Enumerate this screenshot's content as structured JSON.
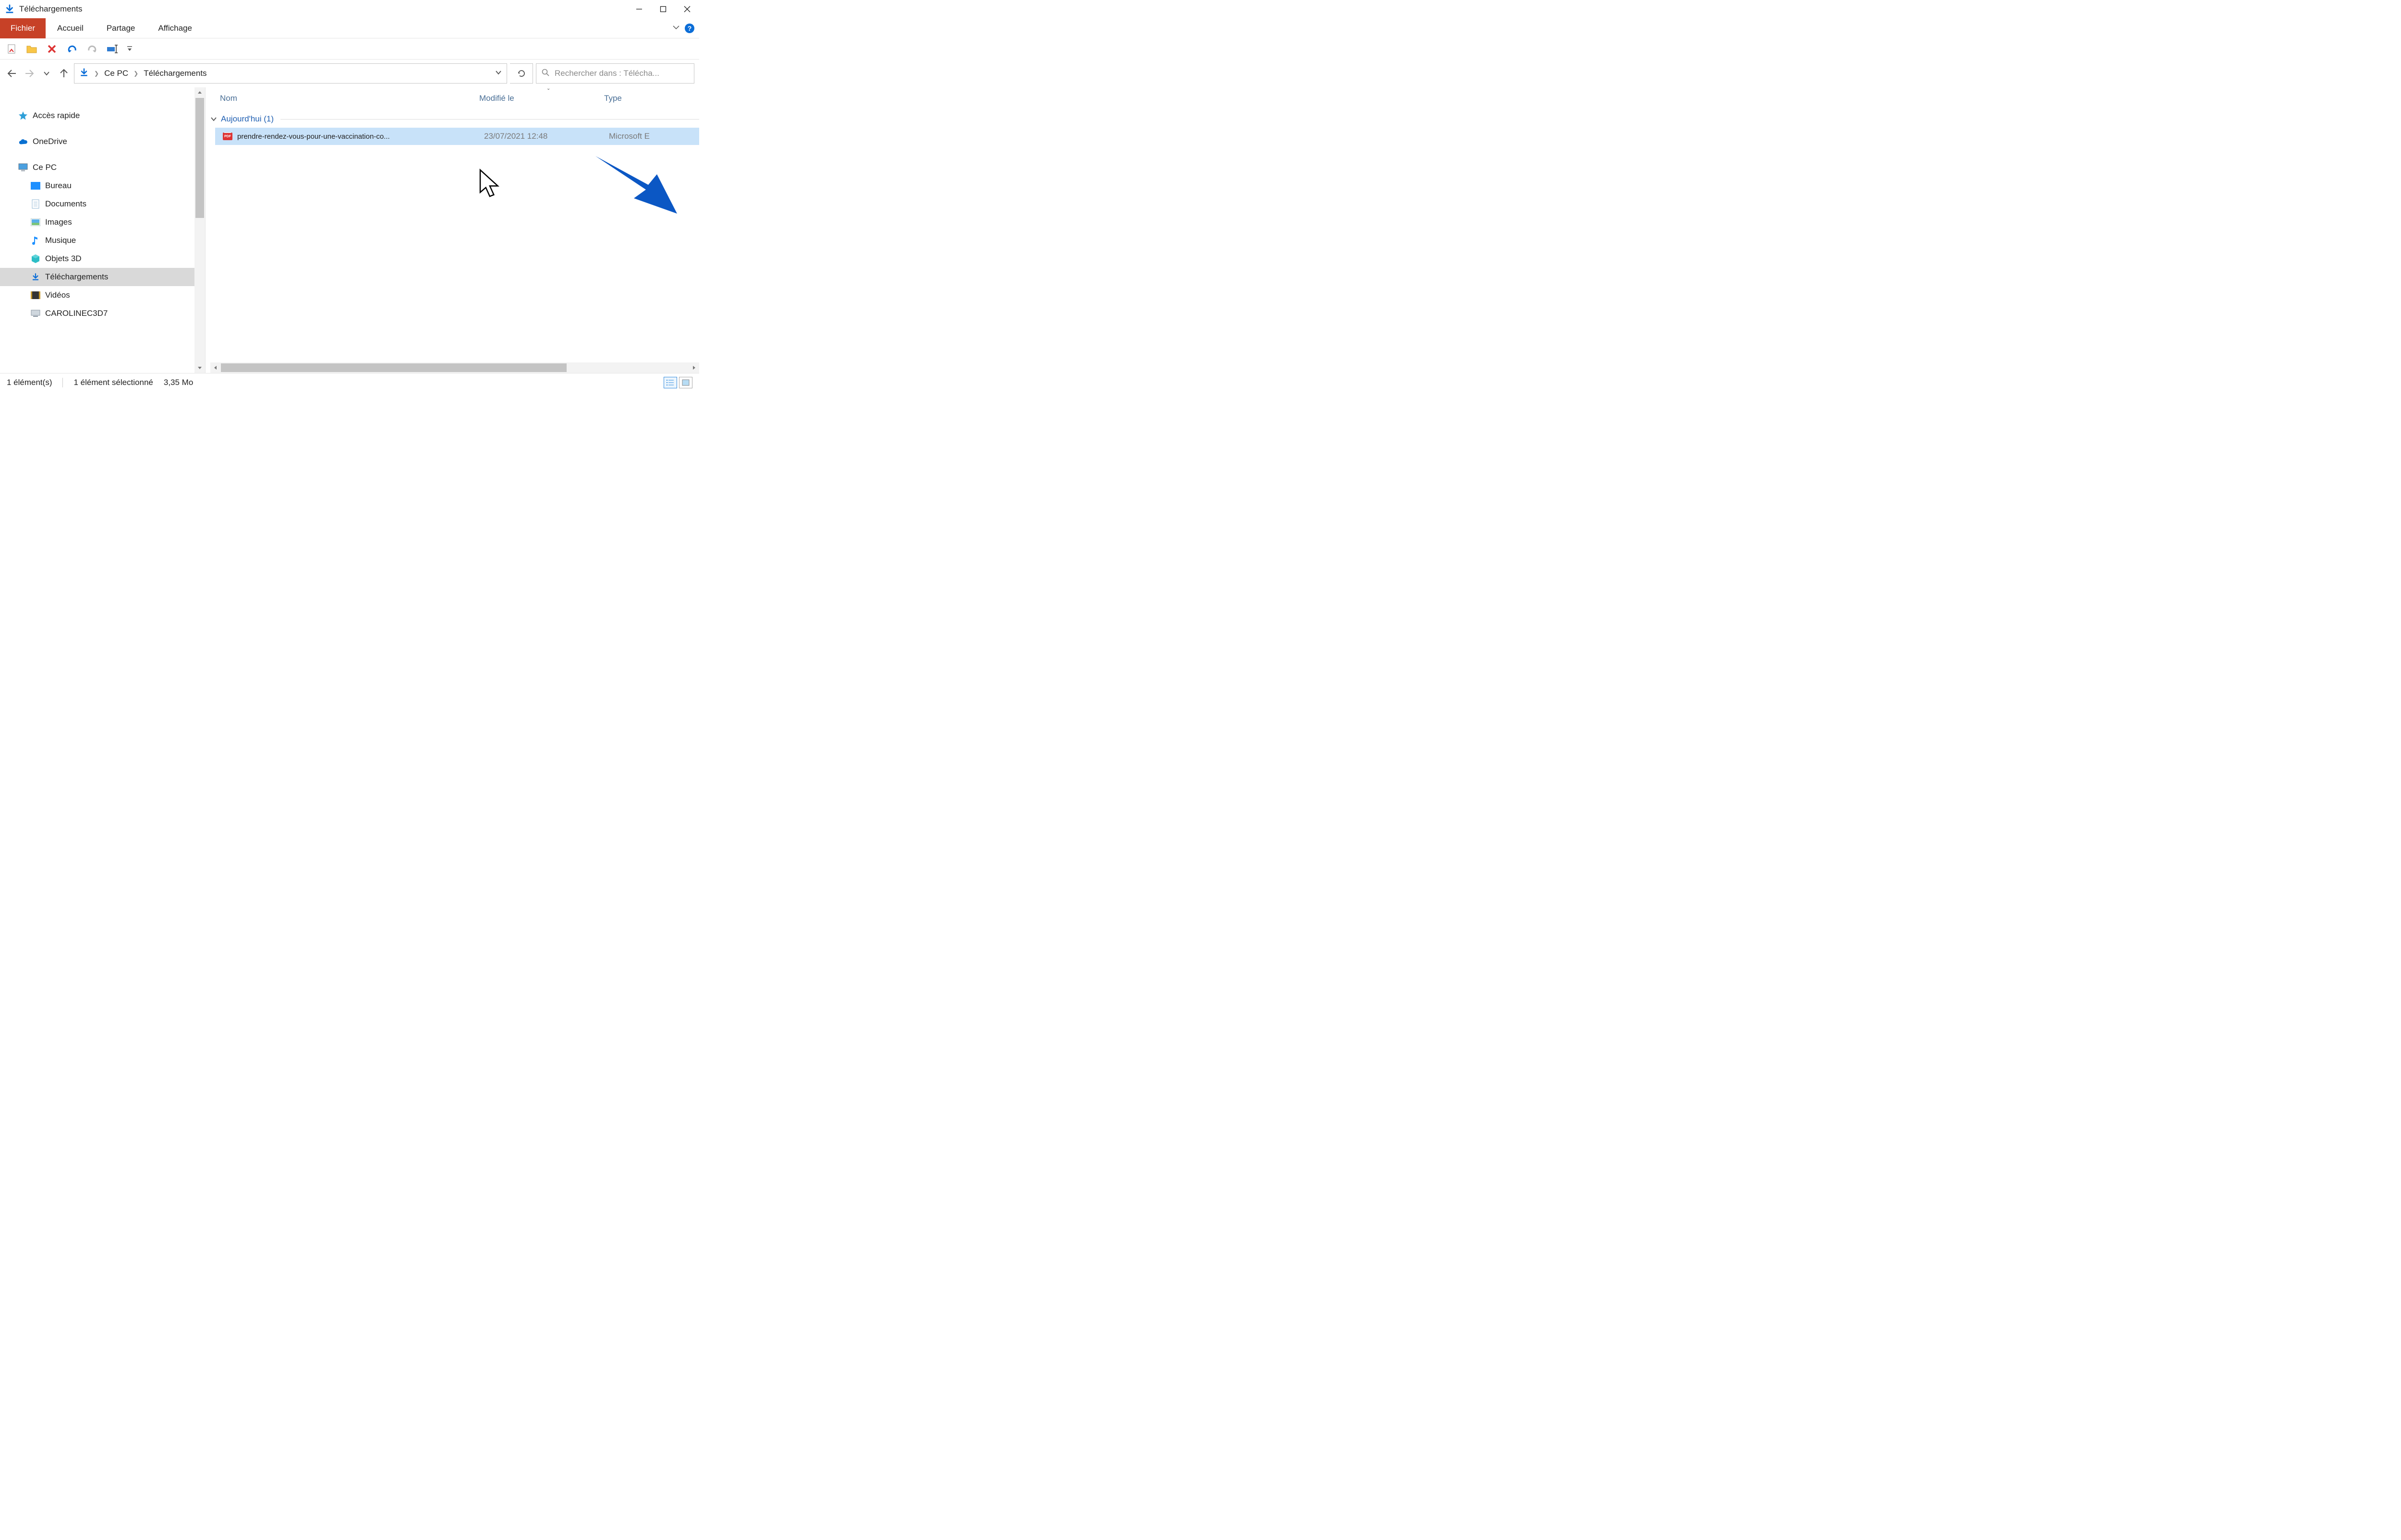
{
  "window": {
    "title": "Téléchargements"
  },
  "tabs": {
    "file": "Fichier",
    "home": "Accueil",
    "share": "Partage",
    "view": "Affichage"
  },
  "breadcrumb": {
    "root": "Ce PC",
    "current": "Téléchargements"
  },
  "search": {
    "placeholder": "Rechercher dans : Télécha..."
  },
  "sidebar": {
    "quick_access": "Accès rapide",
    "onedrive": "OneDrive",
    "this_pc": "Ce PC",
    "desktop": "Bureau",
    "documents": "Documents",
    "images": "Images",
    "music": "Musique",
    "objects3d": "Objets 3D",
    "downloads": "Téléchargements",
    "videos": "Vidéos",
    "computer_name": "CAROLINEC3D7"
  },
  "columns": {
    "name": "Nom",
    "modified": "Modifié le",
    "type": "Type"
  },
  "group": {
    "today": "Aujourd'hui (1)"
  },
  "file": {
    "name": "prendre-rendez-vous-pour-une-vaccination-co...",
    "modified": "23/07/2021 12:48",
    "type": "Microsoft E"
  },
  "status": {
    "count": "1 élément(s)",
    "selection": "1 élément sélectionné",
    "size": "3,35 Mo"
  }
}
